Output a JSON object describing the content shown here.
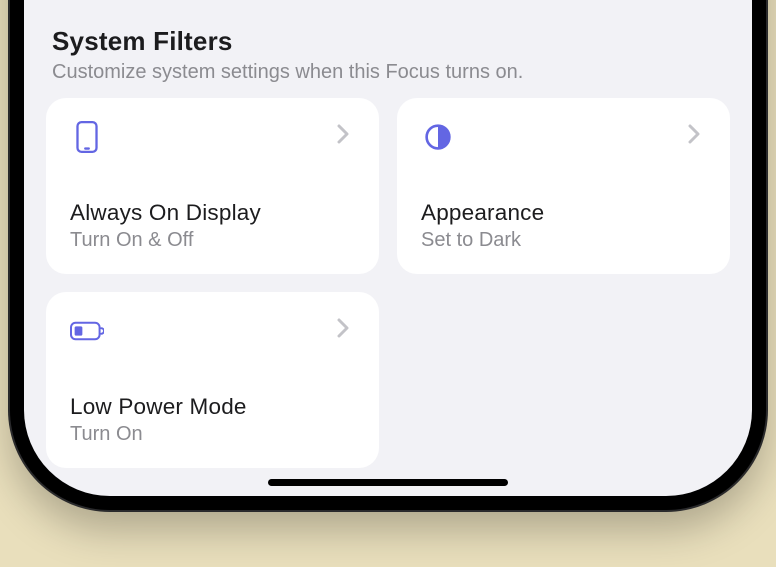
{
  "accent_color": "#6366e3",
  "section": {
    "title": "System Filters",
    "subtitle": "Customize system settings when this Focus turns on."
  },
  "cards": [
    {
      "icon": "phone-icon",
      "title": "Always On Display",
      "subtitle": "Turn On & Off"
    },
    {
      "icon": "half-circle-icon",
      "title": "Appearance",
      "subtitle": "Set to Dark"
    },
    {
      "icon": "battery-icon",
      "title": "Low Power Mode",
      "subtitle": "Turn On"
    }
  ]
}
